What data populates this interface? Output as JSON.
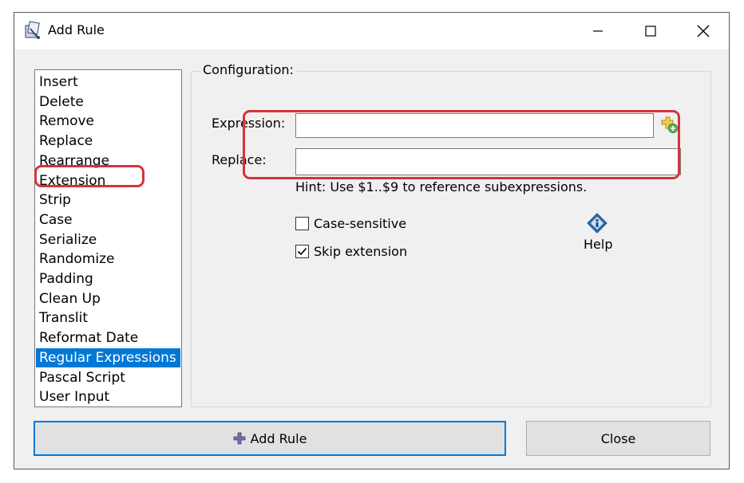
{
  "window": {
    "title": "Add Rule",
    "minimize_label": "Minimize",
    "maximize_label": "Maximize",
    "close_label": "Close window"
  },
  "rules": {
    "items": [
      "Insert",
      "Delete",
      "Remove",
      "Replace",
      "Rearrange",
      "Extension",
      "Strip",
      "Case",
      "Serialize",
      "Randomize",
      "Padding",
      "Clean Up",
      "Translit",
      "Reformat Date",
      "Regular Expressions",
      "Pascal Script",
      "User Input"
    ],
    "selected": "Regular Expressions"
  },
  "config": {
    "group_title": "Configuration:",
    "expression_label": "Expression:",
    "expression_value": "",
    "replace_label": "Replace:",
    "replace_value": "",
    "hint": "Hint: Use $1..$9 to reference subexpressions.",
    "case_sensitive_label": "Case-sensitive",
    "case_sensitive_checked": false,
    "skip_extension_label": "Skip extension",
    "skip_extension_checked": true,
    "help_label": "Help"
  },
  "buttons": {
    "add_rule_label": "Add Rule",
    "close_label": "Close"
  },
  "colors": {
    "selection": "#0078d7",
    "annotation": "#d2343a",
    "dialog_bg": "#f0f0f0"
  }
}
